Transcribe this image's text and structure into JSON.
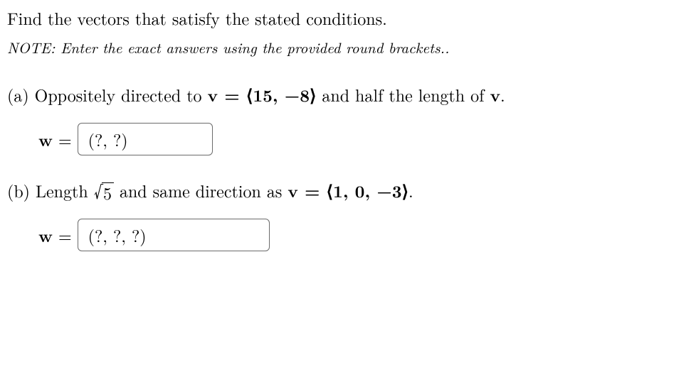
{
  "prompt": "Find the vectors that satisfy the stated conditions.",
  "note": "NOTE: Enter the exact answers using the provided round brackets..",
  "partA": {
    "label": "(a) Oppositely directed to ",
    "v_eq": "v = ⟨15, −8⟩",
    "rest": " and half the length of ",
    "v_end": "v",
    "period": "."
  },
  "partB": {
    "label": "(b) Length ",
    "sqrt_val": "5",
    "mid": " and same direction as ",
    "v_eq": "v = ⟨1, 0, −3⟩",
    "period": "."
  },
  "answers": {
    "w_label": "w =",
    "a_placeholder": "(?, ?)",
    "b_placeholder": "(?, ?, ?)"
  }
}
